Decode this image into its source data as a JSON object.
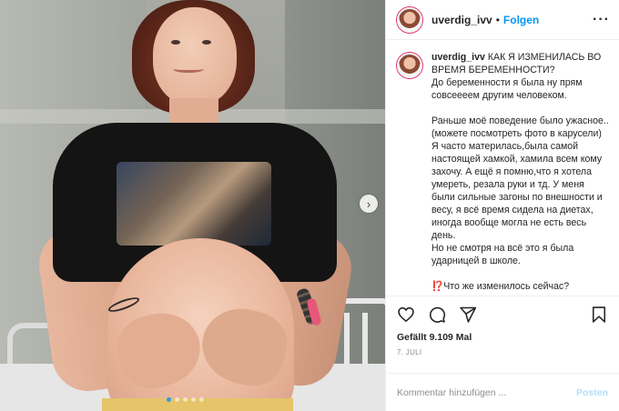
{
  "photo": {
    "carousel_total": 5,
    "carousel_active": 1
  },
  "header": {
    "username": "uverdig_ivv",
    "separator": "•",
    "follow_label": "Folgen",
    "more_icon": "more-horizontal-icon"
  },
  "caption": {
    "username": "uverdig_ivv",
    "text": " КАК Я ИЗМЕНИЛАСЬ ВО ВРЕМЯ БЕРЕМЕННОСТИ?\nДо беременности я была ну прям совсеееем другим человеком.\n\nРаньше моё поведение было ужасное..(можете посмотреть фото в карусели)\nЯ часто материлась,была самой настоящей хамкой, хамила всем кому захочу. А ещё я помню,что я хотела умереть, резала руки и тд. У меня были сильные загоны по внешности и весу, я всё время сидела на диетах, иногда вообще могла не есть весь день.\nНо не смотря на всё это я была ударницей в школе.\n\n⁉️Что же изменилось сейчас?"
  },
  "actions": {
    "like_icon": "heart-icon",
    "comment_icon": "comment-icon",
    "share_icon": "share-icon",
    "save_icon": "bookmark-icon"
  },
  "likes_text": "Gefällt 9.109 Mal",
  "date_text": "7. JULI",
  "comment": {
    "placeholder": "Kommentar hinzufügen ...",
    "post_label": "Posten"
  },
  "colors": {
    "link_blue": "#0095f6",
    "post_disabled": "#b2dffc",
    "story_ring": "#e1306c"
  }
}
